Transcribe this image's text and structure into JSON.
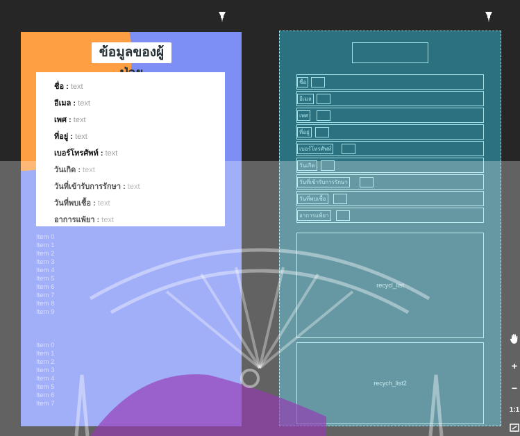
{
  "design": {
    "title": "ข้อมูลของผู้ป่วย",
    "fields": [
      {
        "key": "ชื่อ :",
        "value": "text"
      },
      {
        "key": "อีเมล :",
        "value": "text"
      },
      {
        "key": "เพศ :",
        "value": "text"
      },
      {
        "key": "ที่อยู่ :",
        "value": "text"
      },
      {
        "key": "เบอร์โทรศัพท์ :",
        "value": "text"
      },
      {
        "key": "วันเกิด :",
        "value": "text"
      },
      {
        "key": "วันที่เข้ารับการรักษา :",
        "value": "text"
      },
      {
        "key": "วันที่พบเชื้อ :",
        "value": "text"
      },
      {
        "key": "อาการแพ้ยา :",
        "value": "text"
      }
    ],
    "list_a": [
      "Item 0",
      "Item 1",
      "Item 2",
      "Item 3",
      "Item 4",
      "Item 5",
      "Item 6",
      "Item 7",
      "Item 8",
      "Item 9"
    ],
    "list_b": [
      "Item 0",
      "Item 1",
      "Item 2",
      "Item 3",
      "Item 4",
      "Item 5",
      "Item 6",
      "Item 7"
    ]
  },
  "blueprint": {
    "labels": [
      "ชื่อ",
      "อีเมล",
      "เพศ",
      "ที่อยู่",
      "เบอร์โทรศัพท์",
      "วันเกิด",
      "วันที่เข้ารับการรักษา",
      "วันที่พบเชื้อ",
      "อาการแพ้ยา"
    ],
    "recycler_a": "recycl_list",
    "recycler_b": "recych_list2"
  },
  "tools": {
    "pan_icon": "hand-icon",
    "zoom_in": "+",
    "zoom_out": "−",
    "ratio": "1:1",
    "fit_icon": "fit-screen-icon"
  },
  "colors": {
    "canvas": "#262626",
    "design_bg": "#7d8ff5",
    "blob": "#ff9f43",
    "blueprint_bg": "#2c7180",
    "blueprint_line": "#a6e3ea"
  }
}
